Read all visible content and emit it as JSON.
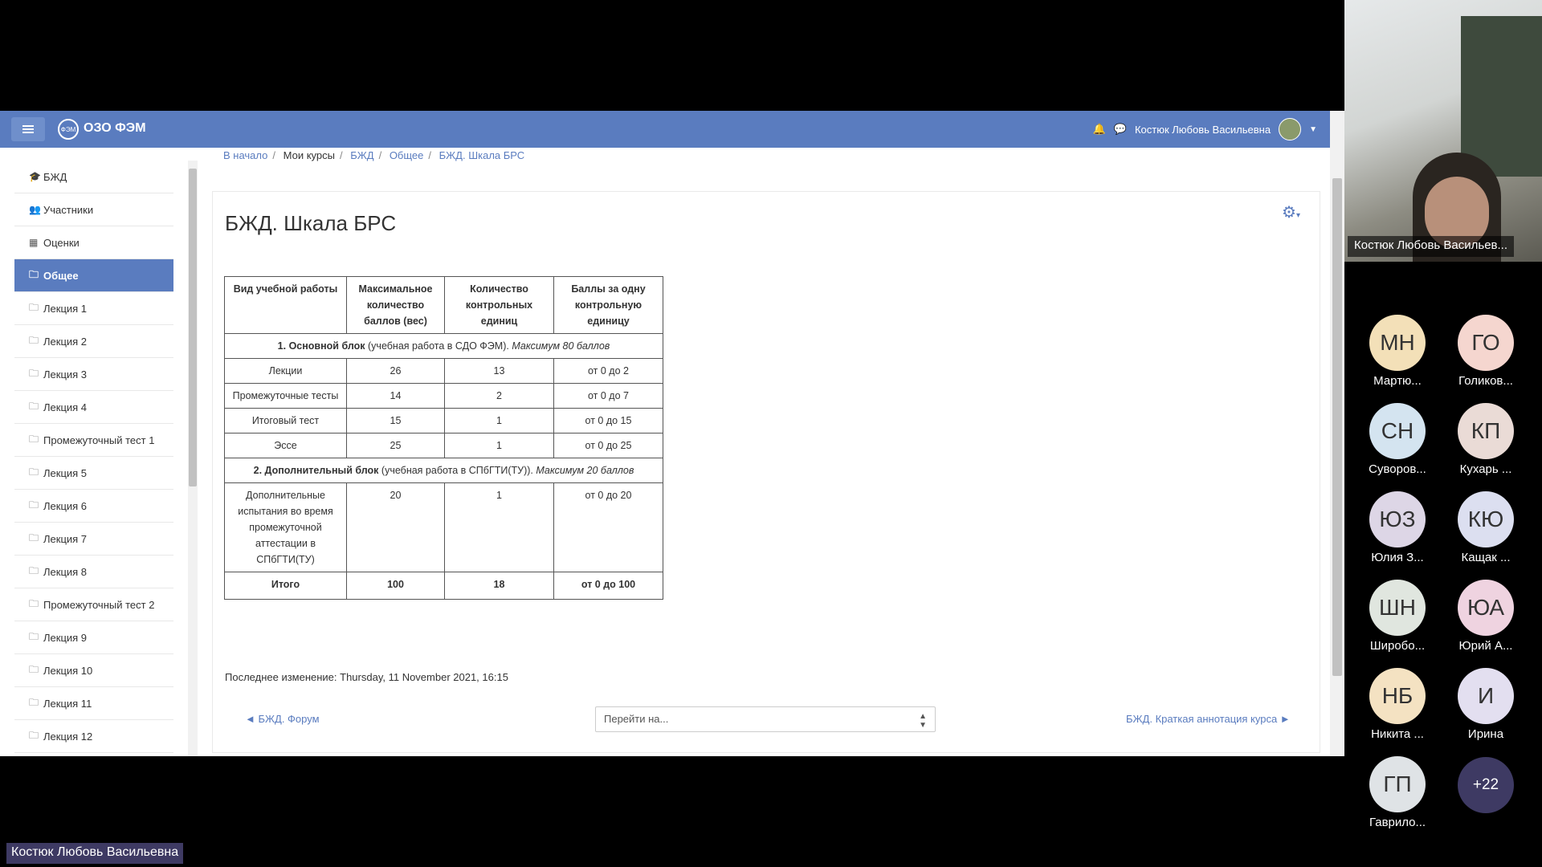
{
  "site": {
    "name": "ОЗО ФЭМ",
    "logo_text": "ФЭМ"
  },
  "header": {
    "user_name": "Костюк Любовь Васильевна"
  },
  "breadcrumb": [
    "В начало",
    "Мои курсы",
    "БЖД",
    "Общее",
    "БЖД. Шкала БРС"
  ],
  "sidebar": {
    "items": [
      {
        "icon": "graduation-cap-icon",
        "glyph": "🎓",
        "label": "БЖД"
      },
      {
        "icon": "users-icon",
        "glyph": "👥",
        "label": "Участники"
      },
      {
        "icon": "table-icon",
        "glyph": "▦",
        "label": "Оценки"
      },
      {
        "icon": "folder-icon",
        "glyph": "🗀",
        "label": "Общее",
        "active": true
      },
      {
        "icon": "folder-icon",
        "glyph": "🗀",
        "label": "Лекция 1"
      },
      {
        "icon": "folder-icon",
        "glyph": "🗀",
        "label": "Лекция 2"
      },
      {
        "icon": "folder-icon",
        "glyph": "🗀",
        "label": "Лекция 3"
      },
      {
        "icon": "folder-icon",
        "glyph": "🗀",
        "label": "Лекция 4"
      },
      {
        "icon": "folder-icon",
        "glyph": "🗀",
        "label": "Промежуточный тест 1"
      },
      {
        "icon": "folder-icon",
        "glyph": "🗀",
        "label": "Лекция 5"
      },
      {
        "icon": "folder-icon",
        "glyph": "🗀",
        "label": "Лекция 6"
      },
      {
        "icon": "folder-icon",
        "glyph": "🗀",
        "label": "Лекция 7"
      },
      {
        "icon": "folder-icon",
        "glyph": "🗀",
        "label": "Лекция 8"
      },
      {
        "icon": "folder-icon",
        "glyph": "🗀",
        "label": "Промежуточный тест 2"
      },
      {
        "icon": "folder-icon",
        "glyph": "🗀",
        "label": "Лекция 9"
      },
      {
        "icon": "folder-icon",
        "glyph": "🗀",
        "label": "Лекция 10"
      },
      {
        "icon": "folder-icon",
        "glyph": "🗀",
        "label": "Лекция 11"
      },
      {
        "icon": "folder-icon",
        "glyph": "🗀",
        "label": "Лекция 12"
      }
    ]
  },
  "page": {
    "title": "БЖД. Шкала БРС",
    "table": {
      "headers": [
        "Вид учебной работы",
        "Максимальное количество баллов (вес)",
        "Количество контрольных единиц",
        "Баллы за одну контрольную единицу"
      ],
      "block1": {
        "bold": "1. Основной блок",
        "normal": " (учебная работа в СДО ФЭМ). ",
        "italic": "Максимум 80 баллов"
      },
      "block1_rows": [
        [
          "Лекции",
          "26",
          "13",
          "от 0 до 2"
        ],
        [
          "Промежуточные тесты",
          "14",
          "2",
          "от 0 до 7"
        ],
        [
          "Итоговый тест",
          "15",
          "1",
          "от 0 до 15"
        ],
        [
          "Эссе",
          "25",
          "1",
          "от 0 до 25"
        ]
      ],
      "block2": {
        "bold": "2. Дополнительный блок",
        "normal": " (учебная работа в СПбГТИ(ТУ)). ",
        "italic": "Максимум 20 баллов"
      },
      "block2_rows": [
        [
          "Дополнительные испытания во время промежуточной аттестации в СПбГТИ(ТУ)",
          "20",
          "1",
          "от 0 до 20"
        ]
      ],
      "total": [
        "Итого",
        "100",
        "18",
        "от 0 до 100"
      ]
    },
    "last_modified": "Последнее изменение: Thursday, 11 November 2021, 16:15",
    "prev_link": "◄ БЖД. Форум",
    "goto_placeholder": "Перейти на...",
    "next_link": "БЖД. Краткая аннотация курса ►"
  },
  "zoom": {
    "speaker_label": "Костюк Любовь Васильев...",
    "participants": [
      {
        "initials": "МН",
        "name": "Мартю...",
        "color": "#f3e0b8"
      },
      {
        "initials": "ГО",
        "name": "Голиков...",
        "color": "#f5d6cf"
      },
      {
        "initials": "СН",
        "name": "Суворов...",
        "color": "#d4e4f0"
      },
      {
        "initials": "КП",
        "name": "Кухарь ...",
        "color": "#eadbd6"
      },
      {
        "initials": "ЮЗ",
        "name": "Юлия З...",
        "color": "#ddd6e6"
      },
      {
        "initials": "КЮ",
        "name": "Кащак ...",
        "color": "#dcdff0"
      },
      {
        "initials": "ШН",
        "name": "Широбо...",
        "color": "#e0e6df"
      },
      {
        "initials": "ЮА",
        "name": "Юрий А...",
        "color": "#efd3e0"
      },
      {
        "initials": "НБ",
        "name": "Никита ...",
        "color": "#f4e2c2"
      },
      {
        "initials": "И",
        "name": "Ирина",
        "color": "#e3dff0"
      },
      {
        "initials": "ГП",
        "name": "Гаврило...",
        "color": "#dfe3e6"
      }
    ],
    "more_count": "+22",
    "bottom_label": "Костюк Любовь Васильевна"
  }
}
